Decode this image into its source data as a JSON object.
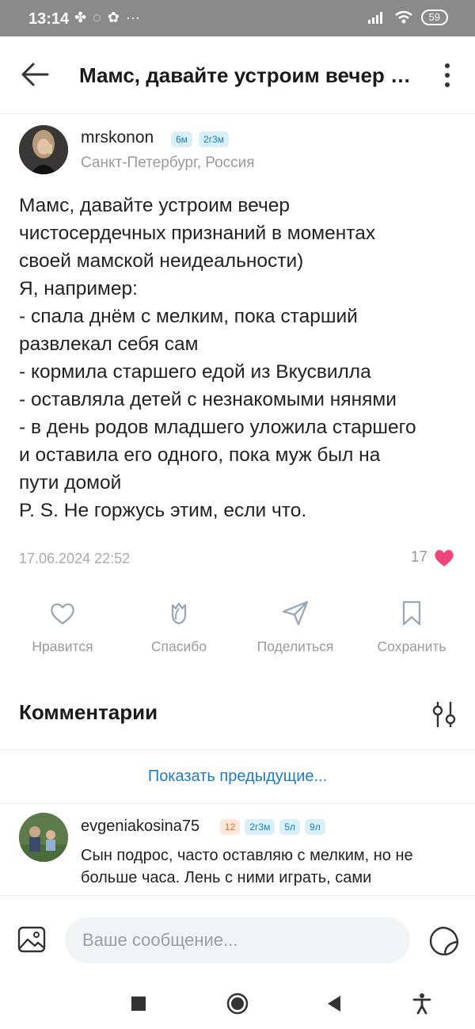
{
  "status_bar": {
    "time": "13:14",
    "battery": "59"
  },
  "header": {
    "title": "Мамс, давайте устроим вечер ч..."
  },
  "post": {
    "author": {
      "username": "mrskonon",
      "badges": [
        "6м",
        "2г3м"
      ],
      "location": "Санкт-Петербург, Россия"
    },
    "text": "Мамс, давайте устроим вечер\nчистосердечных признаний в моментах\nсвоей мамской неидеальности)\nЯ, например:\n- спала днём с мелким, пока старший\nразвлекал себя сам\n- кормила старшего едой из Вкусвилла\n- оставляла детей с незнакомыми нянями\n- в день родов младшего уложила старшего\nи оставила его одного, пока муж был на\nпути домой\n P. S. Не горжусь этим, если что.",
    "date": "17.06.2024 22:52",
    "likes": "17"
  },
  "actions": {
    "like": "Нравится",
    "thanks": "Спасибо",
    "share": "Поделиться",
    "save": "Сохранить"
  },
  "comments": {
    "heading": "Комментарии",
    "show_previous": "Показать предыдущие...",
    "items": [
      {
        "username": "evgeniakosina75",
        "badges": [
          "12",
          "2г3м",
          "5л",
          "9л"
        ],
        "text": "Сын подрос, часто оставляю с мелким, но не больше часа. Лень с ними играть, сами"
      }
    ]
  },
  "composer": {
    "placeholder": "Ваше сообщение..."
  },
  "colors": {
    "accent": "#1c7bc9",
    "like": "#f0457a",
    "badge_bg": "#d9f0fb",
    "badge_text": "#1c7bb8"
  }
}
